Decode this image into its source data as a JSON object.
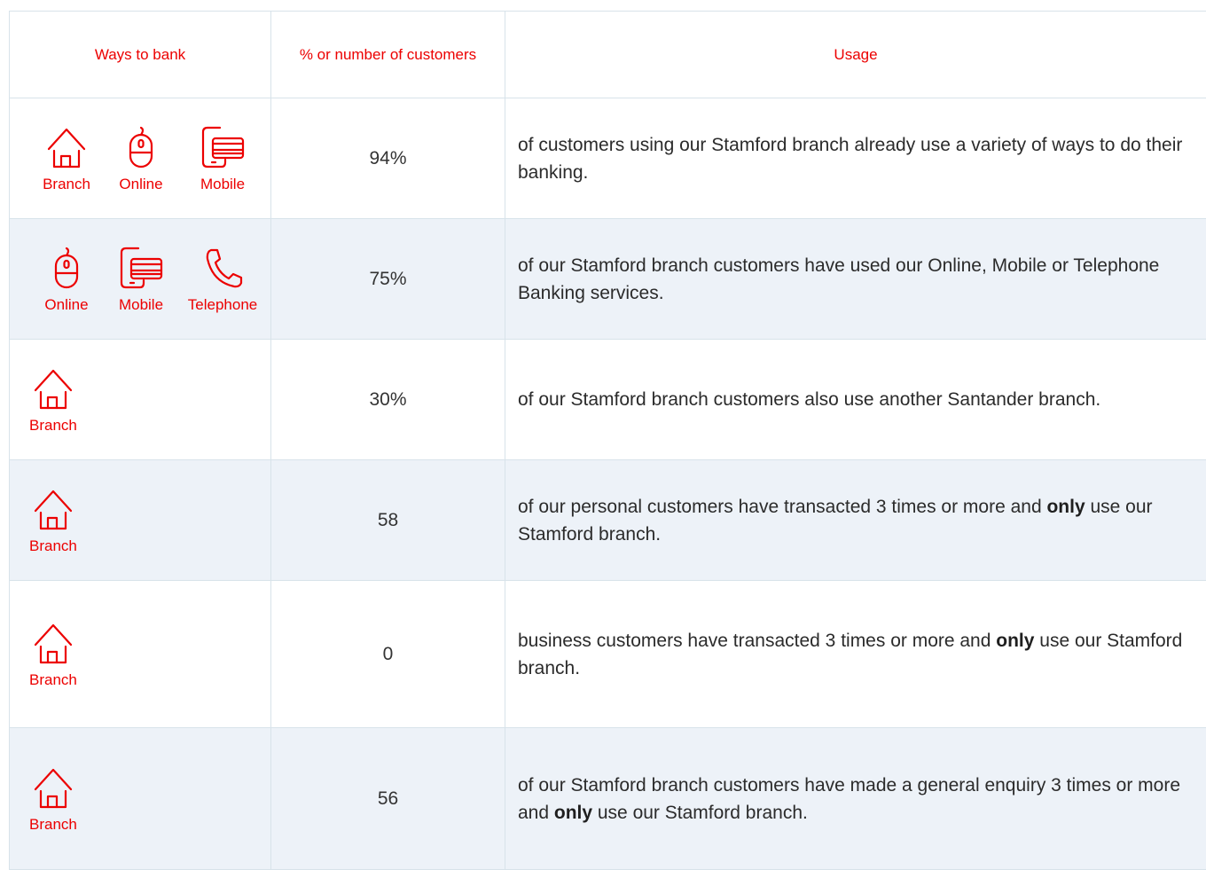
{
  "headers": {
    "ways": "Ways to bank",
    "pct": "% or number of customers",
    "usage": "Usage"
  },
  "rows": [
    {
      "icons": [
        {
          "name": "branch-icon",
          "label": "Branch"
        },
        {
          "name": "online-mouse-icon",
          "label": "Online"
        },
        {
          "name": "mobile-card-icon",
          "label": "Mobile"
        }
      ],
      "value": "94%",
      "usage_pre": "of customers using our Stamford branch already use a variety of ways to do their banking.",
      "usage_bold": "",
      "usage_post": ""
    },
    {
      "icons": [
        {
          "name": "online-mouse-icon",
          "label": "Online"
        },
        {
          "name": "mobile-card-icon",
          "label": "Mobile"
        },
        {
          "name": "telephone-icon",
          "label": "Telephone"
        }
      ],
      "value": "75%",
      "usage_pre": "of our Stamford branch customers have used our Online, Mobile or Telephone Banking services.",
      "usage_bold": "",
      "usage_post": ""
    },
    {
      "icons": [
        {
          "name": "branch-icon",
          "label": "Branch"
        }
      ],
      "value": "30%",
      "usage_pre": "of our Stamford branch customers also use another Santander branch.",
      "usage_bold": "",
      "usage_post": ""
    },
    {
      "icons": [
        {
          "name": "branch-icon",
          "label": "Branch"
        }
      ],
      "value": "58",
      "usage_pre": "of our personal customers have transacted 3 times or more and ",
      "usage_bold": "only",
      "usage_post": " use our Stamford branch."
    },
    {
      "icons": [
        {
          "name": "branch-icon",
          "label": "Branch"
        }
      ],
      "value": "0",
      "usage_pre": "business customers have transacted 3 times or more and ",
      "usage_bold": "only",
      "usage_post": " use our Stamford branch."
    },
    {
      "icons": [
        {
          "name": "branch-icon",
          "label": "Branch"
        }
      ],
      "value": "56",
      "usage_pre": "of our Stamford branch customers have made a general enquiry 3 times or more and ",
      "usage_bold": "only",
      "usage_post": " use our Stamford branch."
    }
  ]
}
